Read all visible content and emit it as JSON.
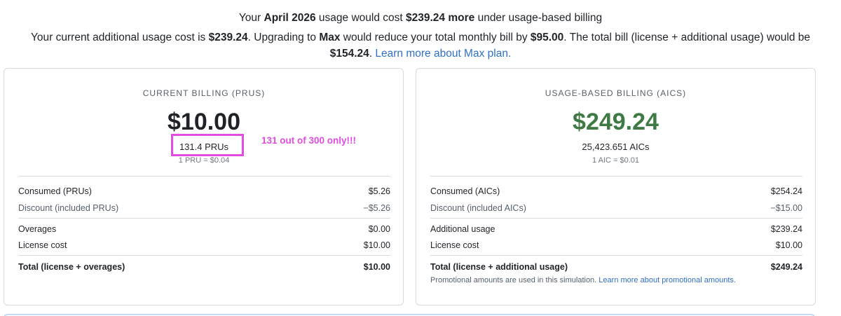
{
  "header": {
    "line1": {
      "t1": "Your ",
      "month": "April 2026",
      "t2": " usage would cost ",
      "amount": "$239.24 more",
      "t3": " under usage-based billing"
    },
    "line2": {
      "t1": "Your current additional usage cost is ",
      "cost": "$239.24",
      "t2": ". Upgrading to ",
      "plan": "Max",
      "t3": " would reduce your total monthly bill by ",
      "savings": "$95.00",
      "t4": ". The total bill (license + additional usage) would be ",
      "total": "$154.24",
      "t5": ". ",
      "link": "Learn more about Max plan."
    }
  },
  "current_billing": {
    "title": "CURRENT BILLING (PRUS)",
    "amount": "$10.00",
    "units": "131.4 PRUs",
    "rate": "1 PRU = $0.04",
    "annotation": "131 out of 300 only!!!",
    "rows": [
      {
        "label": "Consumed (PRUs)",
        "value": "$5.26"
      },
      {
        "label": "Discount (included PRUs)",
        "value": "−$5.26"
      },
      {
        "label": "Overages",
        "value": "$0.00"
      },
      {
        "label": "License cost",
        "value": "$10.00"
      }
    ],
    "total": {
      "label": "Total (license + overages)",
      "value": "$10.00"
    }
  },
  "usage_billing": {
    "title": "USAGE-BASED BILLING (AICS)",
    "amount": "$249.24",
    "units": "25,423.651 AICs",
    "rate": "1 AIC = $0.01",
    "rows": [
      {
        "label": "Consumed (AICs)",
        "value": "$254.24"
      },
      {
        "label": "Discount (included AICs)",
        "value": "−$15.00"
      },
      {
        "label": "Additional usage",
        "value": "$239.24"
      },
      {
        "label": "License cost",
        "value": "$10.00"
      }
    ],
    "total": {
      "label": "Total (license + additional usage)",
      "value": "$249.24"
    },
    "promo_text": "Promotional amounts are used in this simulation. ",
    "promo_link": "Learn more about promotional amounts."
  },
  "colors": {
    "usage_amount": "#3f7a45",
    "link": "#2f6fc4",
    "annotation": "#e14de0"
  }
}
